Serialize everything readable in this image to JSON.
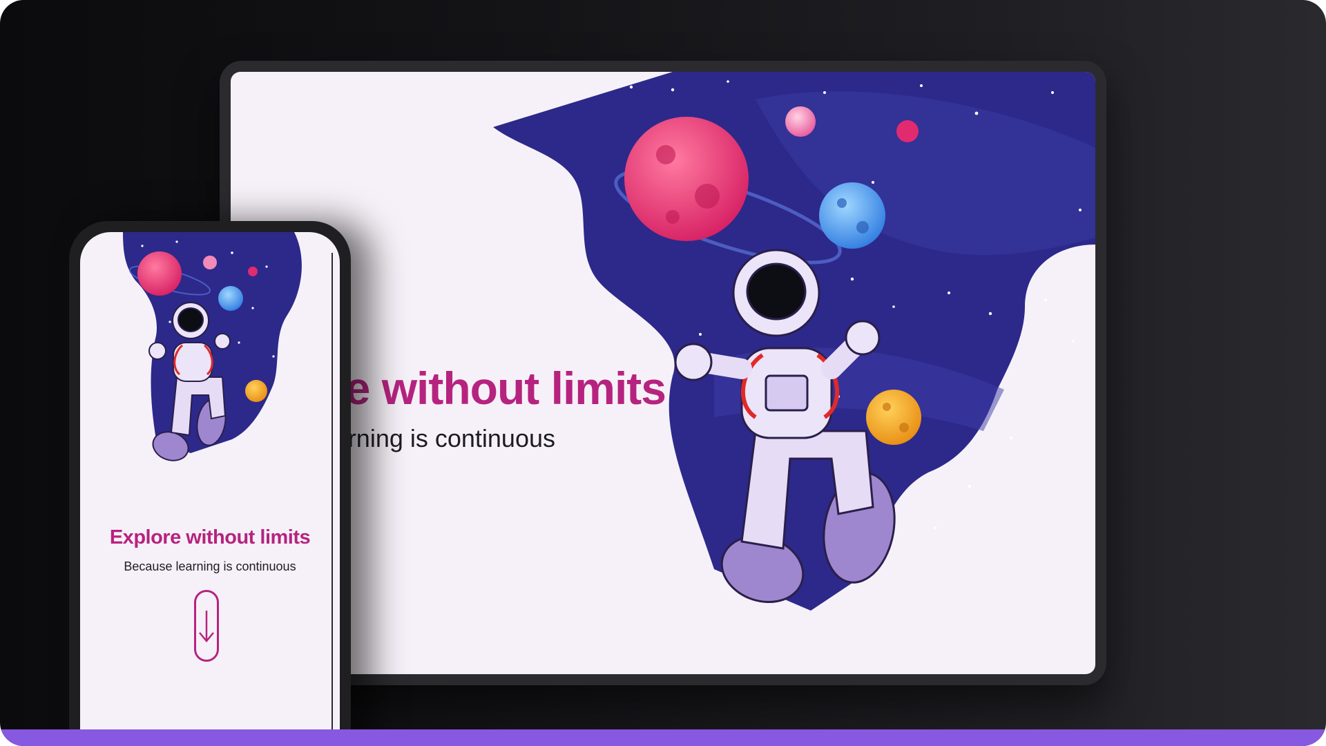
{
  "hero": {
    "title": "Explore without limits",
    "subtitle": "Because learning is continuous",
    "tablet_title_visible": "ore without limits",
    "tablet_subtitle_visible": "earning is continuous"
  },
  "icons": {
    "scroll": "arrow-down-icon",
    "illustration": "astronaut-space-illustration"
  },
  "colors": {
    "accent": "#b6237f",
    "text": "#1c1c22",
    "page_bg": "#f6f1f8",
    "space_bg": "#2b2888",
    "bottom_bar": "#8758e0"
  }
}
